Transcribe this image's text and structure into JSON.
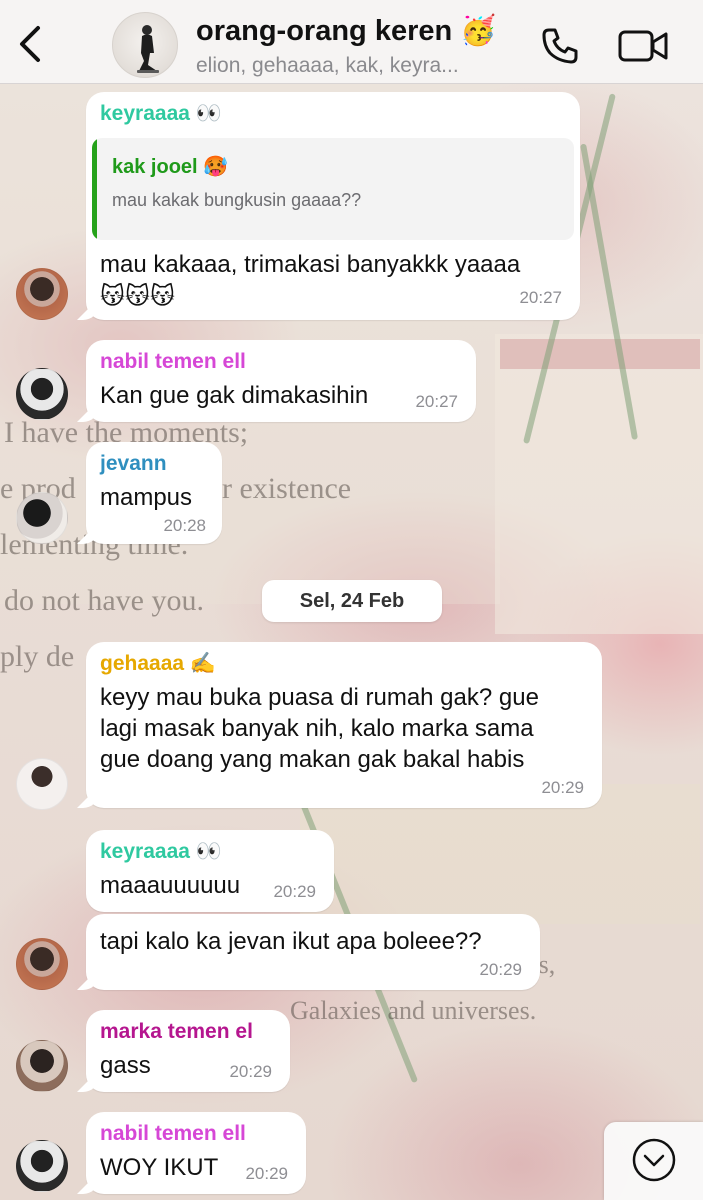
{
  "header": {
    "title": "orang-orang keren 🥳",
    "subtitle": "elion, gehaaaa, kak, keyra..."
  },
  "icons": {
    "back": "chevron-left-icon",
    "call": "phone-icon",
    "video": "video-camera-icon",
    "scroll": "chevron-down-icon"
  },
  "colors": {
    "keyraaaa": "#2fc9a0",
    "nabil": "#d647d6",
    "jevann": "#2f8fbf",
    "gehaaaa": "#e6a800",
    "marka": "#b5168f",
    "quote_accent": "#25a21a"
  },
  "messages": [
    {
      "sender": "keyraaaa 👀",
      "quote": {
        "sender": "kak jooel 🥵",
        "text": "mau kakak bungkusin gaaaa??"
      },
      "lines": [
        "mau kakaaa, trimakasi banyakkk yaaaa",
        "😽😽😽"
      ],
      "time": "20:27"
    },
    {
      "sender": "nabil temen ell",
      "lines": [
        "Kan gue gak dimakasihin"
      ],
      "time": "20:27"
    },
    {
      "sender": "jevann",
      "lines": [
        "mampus"
      ],
      "time": "20:28"
    },
    {
      "sender": "gehaaaa ✍️",
      "lines": [
        "keyy mau buka puasa di rumah gak? gue",
        "lagi masak banyak nih, kalo marka sama",
        "gue doang yang makan gak bakal habis"
      ],
      "time": "20:29"
    },
    {
      "sender": "keyraaaa 👀",
      "lines": [
        "maaauuuuuu"
      ],
      "time": "20:29"
    },
    {
      "lines": [
        "tapi kalo ka jevan ikut apa boleee??"
      ],
      "time": "20:29"
    },
    {
      "sender": "marka temen el",
      "lines": [
        "gass"
      ],
      "time": "20:29"
    },
    {
      "sender": "nabil temen ell",
      "lines": [
        "WOY IKUT"
      ],
      "time": "20:29"
    }
  ],
  "date_separator": "Sel, 24 Feb",
  "wallpaper_text": [
    "I have the moments;",
    "e prod",
    "r existence",
    "lementing time.",
    "do not have you.",
    "ply de",
    "Galaxies and universes.",
    "rs,"
  ]
}
